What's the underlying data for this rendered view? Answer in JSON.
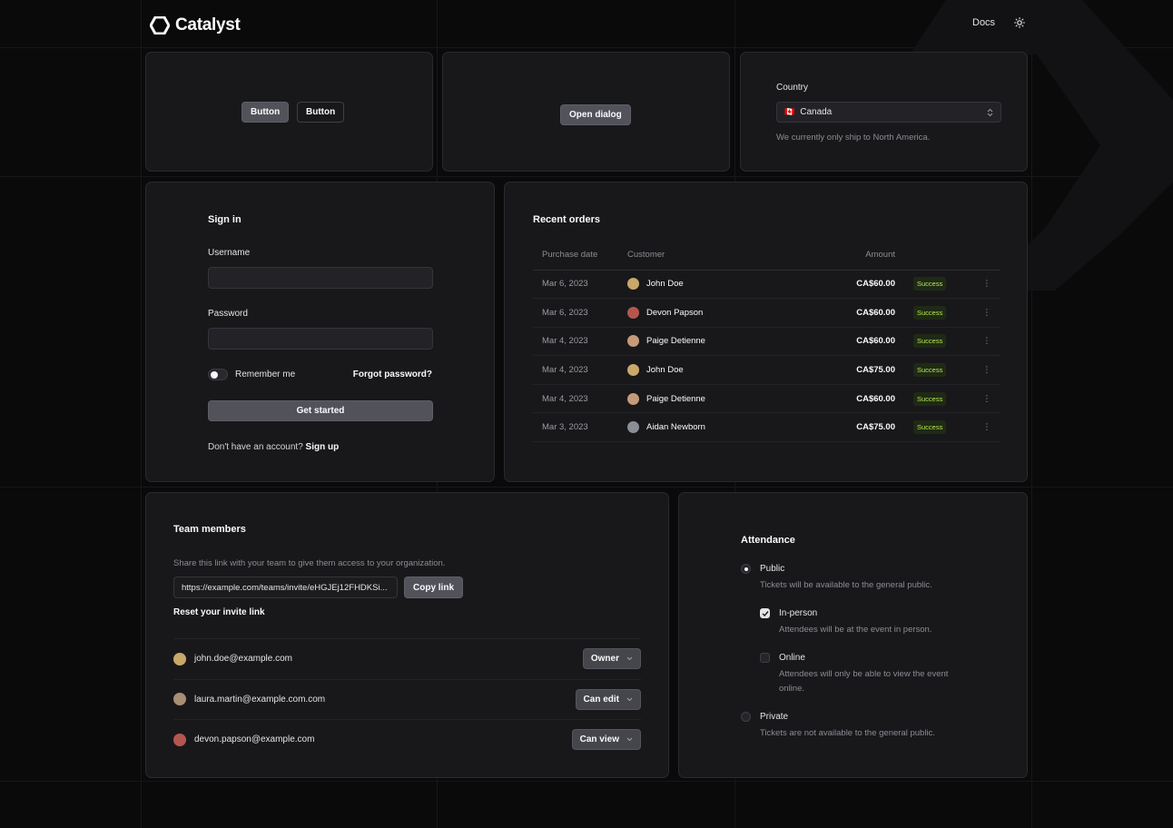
{
  "app": {
    "name": "Catalyst",
    "docs_label": "Docs"
  },
  "buttons_card": {
    "solid_label": "Button",
    "outline_label": "Button"
  },
  "dialog_card": {
    "open_label": "Open dialog"
  },
  "country_card": {
    "label": "Country",
    "selected_flag": "🇨🇦",
    "selected": "Canada",
    "help": "We currently only ship to North America."
  },
  "signin": {
    "title": "Sign in",
    "username_label": "Username",
    "password_label": "Password",
    "remember_label": "Remember me",
    "forgot_label": "Forgot password?",
    "submit_label": "Get started",
    "footer_text": "Don't have an account?",
    "signup_label": "Sign up"
  },
  "orders": {
    "title": "Recent orders",
    "columns": {
      "date": "Purchase date",
      "customer": "Customer",
      "amount": "Amount"
    },
    "rows": [
      {
        "date": "Mar 6, 2023",
        "customer": "John Doe",
        "amount": "CA$60.00",
        "status": "Success",
        "avatar_color": "#c9a86a"
      },
      {
        "date": "Mar 6, 2023",
        "customer": "Devon Papson",
        "amount": "CA$60.00",
        "status": "Success",
        "avatar_color": "#b5564e"
      },
      {
        "date": "Mar 4, 2023",
        "customer": "Paige Detienne",
        "amount": "CA$60.00",
        "status": "Success",
        "avatar_color": "#c49a7a"
      },
      {
        "date": "Mar 4, 2023",
        "customer": "John Doe",
        "amount": "CA$75.00",
        "status": "Success",
        "avatar_color": "#c9a86a"
      },
      {
        "date": "Mar 4, 2023",
        "customer": "Paige Detienne",
        "amount": "CA$60.00",
        "status": "Success",
        "avatar_color": "#c49a7a"
      },
      {
        "date": "Mar 3, 2023",
        "customer": "Aidan Newborn",
        "amount": "CA$75.00",
        "status": "Success",
        "avatar_color": "#8a8f96"
      }
    ]
  },
  "team": {
    "title": "Team members",
    "description": "Share this link with your team to give them access to your organization.",
    "invite_link": "https://example.com/teams/invite/eHGJEj12FHDKSi...",
    "copy_label": "Copy link",
    "reset_label": "Reset your invite link",
    "members": [
      {
        "email": "john.doe@example.com",
        "role": "Owner",
        "avatar_color": "#c9a86a"
      },
      {
        "email": "laura.martin@example.com.com",
        "role": "Can edit",
        "avatar_color": "#a88e72"
      },
      {
        "email": "devon.papson@example.com",
        "role": "Can view",
        "avatar_color": "#b5564e"
      }
    ]
  },
  "attendance": {
    "title": "Attendance",
    "public_label": "Public",
    "public_desc": "Tickets will be available to the general public.",
    "inperson_label": "In-person",
    "inperson_desc": "Attendees will be at the event in person.",
    "online_label": "Online",
    "online_desc_1": "Attendees will only be able to view the event",
    "online_desc_2": "online.",
    "private_label": "Private",
    "private_desc": "Tickets are not available to the general public."
  }
}
